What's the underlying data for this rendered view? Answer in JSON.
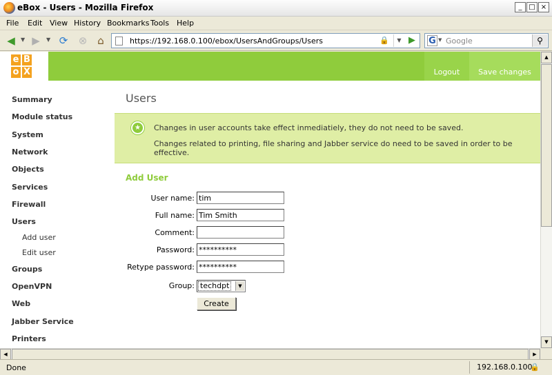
{
  "window": {
    "title": "eBox - Users - Mozilla Firefox",
    "min": "_",
    "max": "□",
    "close": "×"
  },
  "menu": [
    "File",
    "Edit",
    "View",
    "History",
    "Bookmarks",
    "Tools",
    "Help"
  ],
  "nav": {
    "url": "https://192.168.0.100/ebox/UsersAndGroups/Users",
    "search_placeholder": "Google"
  },
  "header": {
    "logo_letters": [
      "e",
      "B",
      "o",
      "X"
    ],
    "logout": "Logout",
    "save_changes": "Save changes",
    "brand_color": "#8fcc3c",
    "logo_color": "#f4a21f"
  },
  "sidebar": {
    "items": [
      "Summary",
      "Module status",
      "System",
      "Network",
      "Objects",
      "Services",
      "Firewall",
      "Users",
      "Groups",
      "OpenVPN",
      "Web",
      "Jabber Service",
      "Printers"
    ],
    "sub_items": [
      "Add user",
      "Edit user"
    ]
  },
  "main": {
    "title": "Users",
    "notice_line1": "Changes in user accounts take effect inmediatiely, they do not need to be saved.",
    "notice_line2": "Changes related to printing, file sharing and Jabber service do need to be saved in order to be effective.",
    "section_title": "Add User"
  },
  "form": {
    "username_label": "User name:",
    "username_value": "tim",
    "fullname_label": "Full name:",
    "fullname_value": "Tim Smith",
    "comment_label": "Comment:",
    "comment_value": "",
    "password_label": "Password:",
    "password_value": "**********",
    "retype_label": "Retype password:",
    "retype_value": "**********",
    "group_label": "Group:",
    "group_value": "techdpt",
    "create_label": "Create"
  },
  "status": {
    "text": "Done",
    "host": "192.168.0.100"
  }
}
